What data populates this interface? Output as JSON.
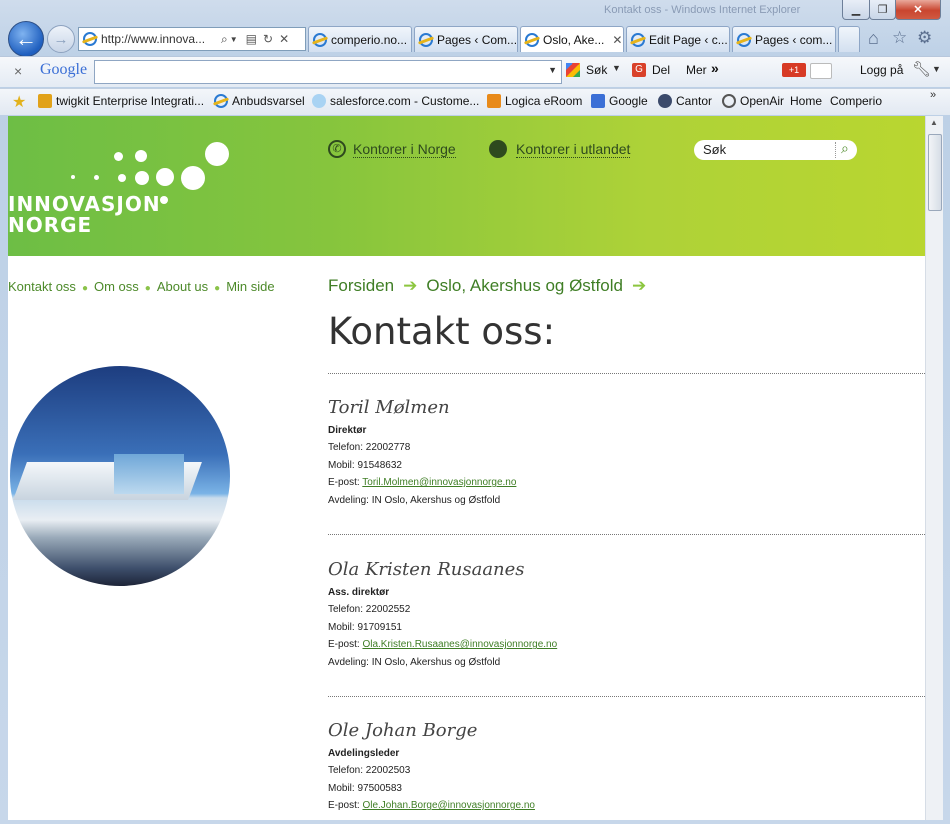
{
  "window": {
    "title_faint": "Kontakt oss - Windows Internet Explorer"
  },
  "nav": {
    "address": "http://www.innova...",
    "back_glyph": "←",
    "forward_glyph": "→"
  },
  "tabs": [
    {
      "label": "comperio.no..."
    },
    {
      "label": "Pages ‹ Com..."
    },
    {
      "label": "Oslo, Ake...",
      "active": true
    },
    {
      "label": "Edit Page ‹ c..."
    },
    {
      "label": "Pages ‹ com..."
    }
  ],
  "google_bar": {
    "close": "×",
    "brand": "Google",
    "search_label": "Søk",
    "share_label": "Del",
    "more_label": "Mer",
    "more_glyph": "»",
    "plusone": "+1",
    "signin": "Logg på"
  },
  "favorites": [
    {
      "label": "twigkit Enterprise Integrati...",
      "color": "#e1a21a"
    },
    {
      "label": "Anbudsvarsel",
      "color": "#2a7ad2"
    },
    {
      "label": "salesforce.com - Custome...",
      "color": "#3fa0de"
    },
    {
      "label": "Logica eRoom",
      "color": "#e88a1a"
    },
    {
      "label": "Google",
      "color": "#3b6fd6"
    },
    {
      "label": "Cantor",
      "color": "#3b4a6b"
    },
    {
      "label": "OpenAir",
      "color": "#555555"
    },
    {
      "label": "Home",
      "color": ""
    },
    {
      "label": "Comperio",
      "color": ""
    }
  ],
  "site": {
    "logo_line1": "INNOVASJON",
    "logo_line2": "NORGE",
    "link_norway": "Kontorer i Norge",
    "link_abroad": "Kontorer i utlandet",
    "search_value": "Søk",
    "brand_green": "#6dbe45"
  },
  "leftnav": [
    "Kontakt oss",
    "Om oss",
    "About us",
    "Min side"
  ],
  "breadcrumb": [
    "Forsiden",
    "Oslo, Akershus og Østfold"
  ],
  "page_title": "Kontakt oss:",
  "contacts": [
    {
      "name": "Toril Mølmen",
      "title": "Direktør",
      "phone": "Telefon: 22002778",
      "mobile": "Mobil: 91548632",
      "email_label": "E-post: ",
      "email": "Toril.Molmen@innovasjonnorge.no",
      "dept": "Avdeling: IN Oslo, Akershus og Østfold"
    },
    {
      "name": "Ola Kristen Rusaanes",
      "title": "Ass. direktør",
      "phone": "Telefon: 22002552",
      "mobile": "Mobil: 91709151",
      "email_label": "E-post: ",
      "email": "Ola.Kristen.Rusaanes@innovasjonnorge.no",
      "dept": "Avdeling: IN Oslo, Akershus og Østfold"
    },
    {
      "name": "Ole Johan Borge",
      "title": "Avdelingsleder",
      "phone": "Telefon: 22002503",
      "mobile": "Mobil: 97500583",
      "email_label": "E-post: ",
      "email": "Ole.Johan.Borge@innovasjonnorge.no"
    }
  ]
}
